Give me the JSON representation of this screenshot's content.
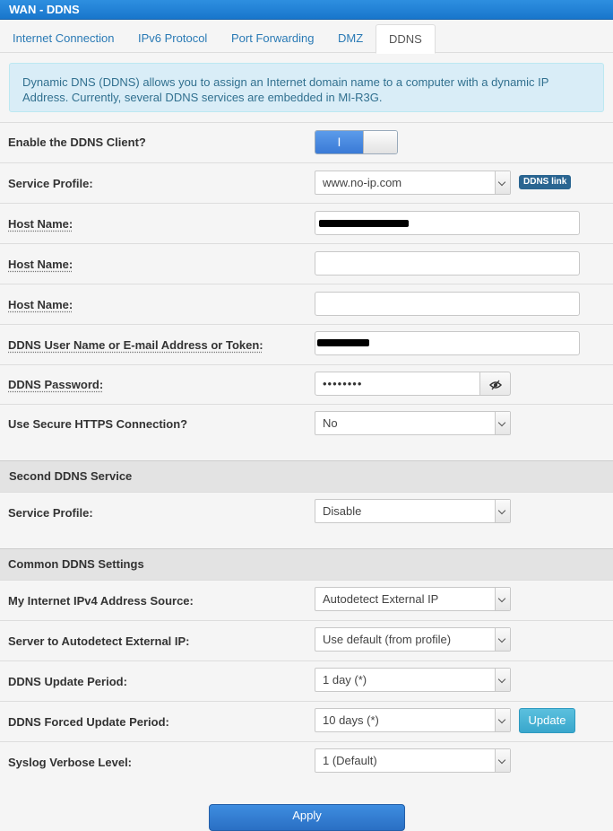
{
  "window": {
    "title": "WAN - DDNS"
  },
  "tabs": [
    {
      "label": "Internet Connection"
    },
    {
      "label": "IPv6 Protocol"
    },
    {
      "label": "Port Forwarding"
    },
    {
      "label": "DMZ"
    },
    {
      "label": "DDNS"
    }
  ],
  "info": "Dynamic DNS (DDNS) allows you to assign an Internet domain name to a computer with a dynamic IP Address. Currently, several DDNS services are embedded in MI-R3G.",
  "fields": {
    "enable": {
      "label": "Enable the DDNS Client?",
      "toggle_on": "I"
    },
    "service_profile": {
      "label": "Service Profile:",
      "value": "www.no-ip.com",
      "link": "DDNS link"
    },
    "host1": {
      "label": "Host Name:",
      "value": ""
    },
    "host2": {
      "label": "Host Name:",
      "value": ""
    },
    "host3": {
      "label": "Host Name:",
      "value": ""
    },
    "username": {
      "label": "DDNS User Name or E-mail Address or Token:",
      "value": ""
    },
    "password": {
      "label": "DDNS Password:",
      "value": "••••••••"
    },
    "https": {
      "label": "Use Secure HTTPS Connection?",
      "value": "No"
    }
  },
  "second": {
    "heading": "Second DDNS Service",
    "service_profile": {
      "label": "Service Profile:",
      "value": "Disable"
    }
  },
  "common": {
    "heading": "Common DDNS Settings",
    "ip_source": {
      "label": "My Internet IPv4 Address Source:",
      "value": "Autodetect External IP"
    },
    "server": {
      "label": "Server to Autodetect External IP:",
      "value": "Use default (from profile)"
    },
    "update_period": {
      "label": "DDNS Update Period:",
      "value": "1 day (*)"
    },
    "forced_period": {
      "label": "DDNS Forced Update Period:",
      "value": "10 days (*)",
      "button": "Update"
    },
    "syslog": {
      "label": "Syslog Verbose Level:",
      "value": "1 (Default)"
    }
  },
  "apply_label": "Apply",
  "colors": {
    "accent": "#1876cc",
    "link": "#2a7ab5",
    "info_bg": "#d9edf7"
  }
}
